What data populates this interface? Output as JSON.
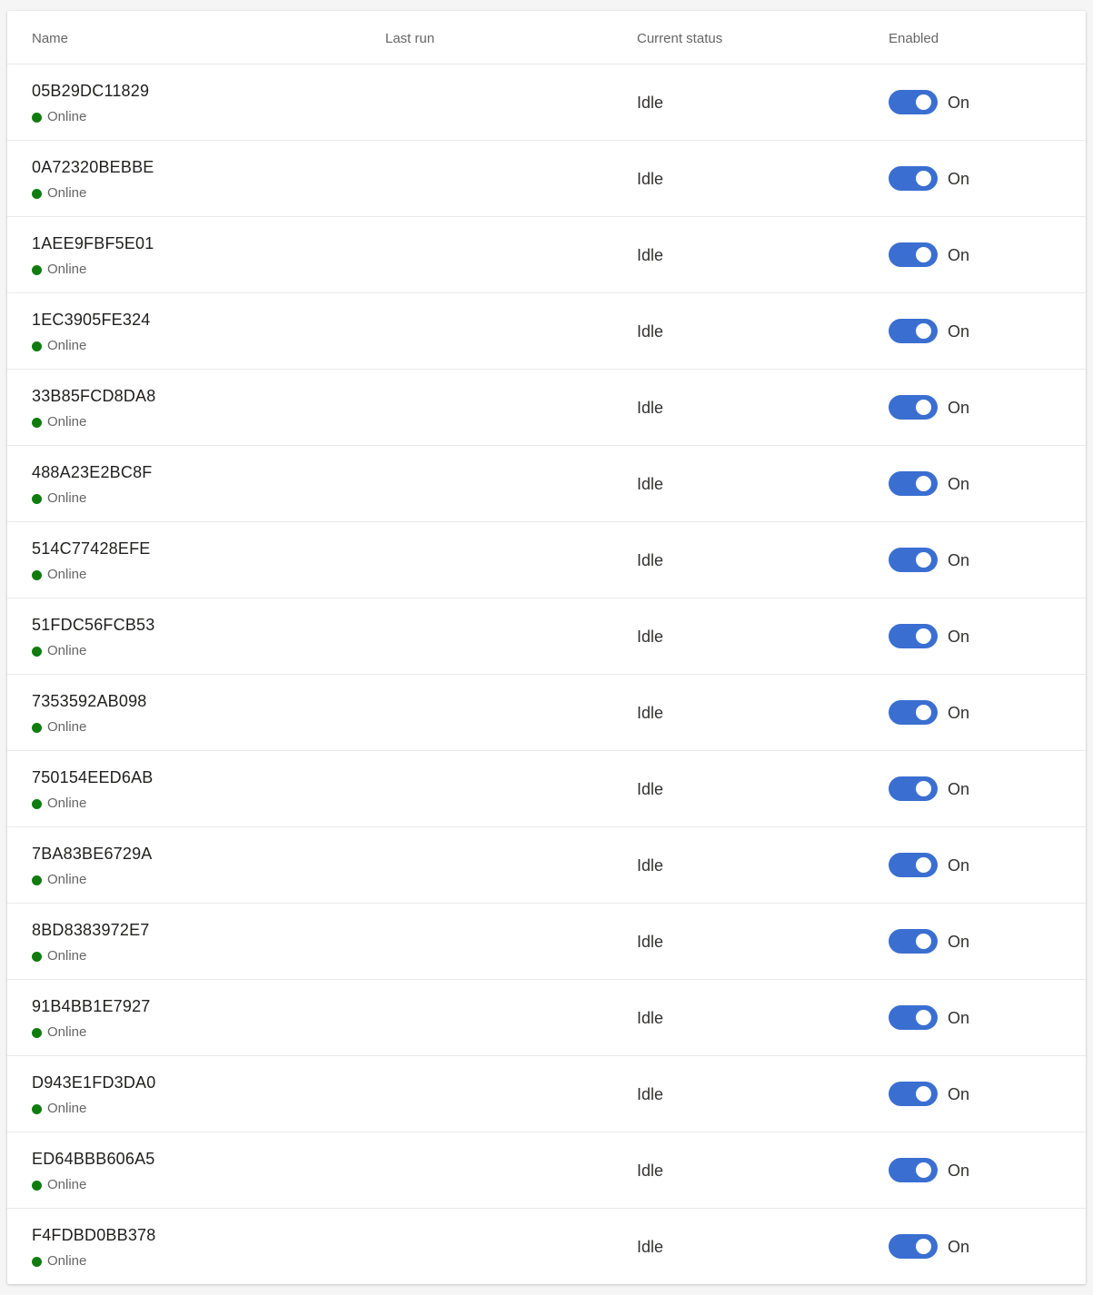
{
  "header": {
    "name": "Name",
    "last_run": "Last run",
    "current_status": "Current status",
    "enabled": "Enabled"
  },
  "colors": {
    "accent": "#3a6fd1",
    "online": "#107c10"
  },
  "rows": [
    {
      "name": "05B29DC11829",
      "connection": "Online",
      "last_run": "",
      "status": "Idle",
      "enabled": "On"
    },
    {
      "name": "0A72320BEBBE",
      "connection": "Online",
      "last_run": "",
      "status": "Idle",
      "enabled": "On"
    },
    {
      "name": "1AEE9FBF5E01",
      "connection": "Online",
      "last_run": "",
      "status": "Idle",
      "enabled": "On"
    },
    {
      "name": "1EC3905FE324",
      "connection": "Online",
      "last_run": "",
      "status": "Idle",
      "enabled": "On"
    },
    {
      "name": "33B85FCD8DA8",
      "connection": "Online",
      "last_run": "",
      "status": "Idle",
      "enabled": "On"
    },
    {
      "name": "488A23E2BC8F",
      "connection": "Online",
      "last_run": "",
      "status": "Idle",
      "enabled": "On"
    },
    {
      "name": "514C77428EFE",
      "connection": "Online",
      "last_run": "",
      "status": "Idle",
      "enabled": "On"
    },
    {
      "name": "51FDC56FCB53",
      "connection": "Online",
      "last_run": "",
      "status": "Idle",
      "enabled": "On"
    },
    {
      "name": "7353592AB098",
      "connection": "Online",
      "last_run": "",
      "status": "Idle",
      "enabled": "On"
    },
    {
      "name": "750154EED6AB",
      "connection": "Online",
      "last_run": "",
      "status": "Idle",
      "enabled": "On"
    },
    {
      "name": "7BA83BE6729A",
      "connection": "Online",
      "last_run": "",
      "status": "Idle",
      "enabled": "On"
    },
    {
      "name": "8BD8383972E7",
      "connection": "Online",
      "last_run": "",
      "status": "Idle",
      "enabled": "On"
    },
    {
      "name": "91B4BB1E7927",
      "connection": "Online",
      "last_run": "",
      "status": "Idle",
      "enabled": "On"
    },
    {
      "name": "D943E1FD3DA0",
      "connection": "Online",
      "last_run": "",
      "status": "Idle",
      "enabled": "On"
    },
    {
      "name": "ED64BBB606A5",
      "connection": "Online",
      "last_run": "",
      "status": "Idle",
      "enabled": "On"
    },
    {
      "name": "F4FDBD0BB378",
      "connection": "Online",
      "last_run": "",
      "status": "Idle",
      "enabled": "On"
    }
  ]
}
